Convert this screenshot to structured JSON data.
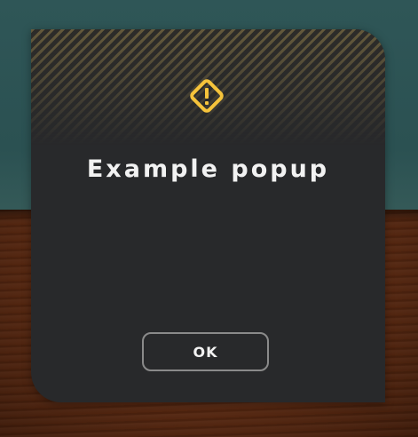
{
  "popup": {
    "title": "Example popup",
    "icon": "warning-icon",
    "ok_label": "OK"
  },
  "colors": {
    "accent": "#f5c33b",
    "panel": "#28292b",
    "text": "#f2f2f2",
    "button_border": "#8a8a8a",
    "backdrop_top": "#2e5455",
    "backdrop_table": "#5c2a12"
  }
}
